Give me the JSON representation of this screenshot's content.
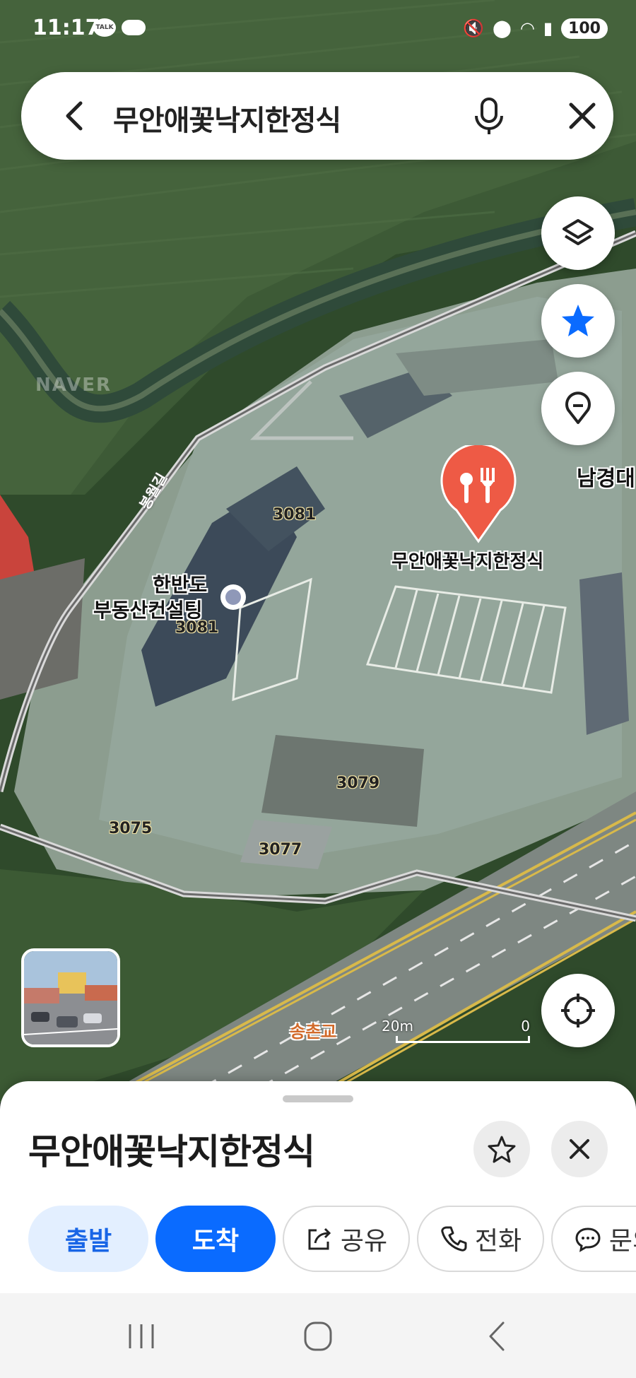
{
  "status_bar": {
    "time": "11:17",
    "talk_badge": "TALK",
    "battery": "100",
    "icons": [
      "kakaotalk-icon",
      "cloud-icon",
      "mute-vibrate-icon",
      "location-icon",
      "wifi-icon",
      "signal-icon",
      "battery-icon"
    ]
  },
  "search": {
    "query": "무안애꽃낙지한정식"
  },
  "map": {
    "watermark": "NAVER",
    "road_name": "봉월길",
    "place_label": "무안애꽃낙지한정식",
    "nearby_place_line1": "한반도",
    "nearby_place_line2": "부동산컨설팅",
    "edge_label": "남경대",
    "bridge_label": "송촌교",
    "lot_numbers": [
      "3081",
      "3081",
      "3079",
      "3075",
      "3077"
    ],
    "scale_left": "20m",
    "scale_right": "0",
    "accent_pin_color": "#ee5a45"
  },
  "sheet": {
    "title": "무안애꽃낙지한정식",
    "actions": {
      "depart": "출발",
      "arrive": "도착",
      "share": "공유",
      "call": "전화",
      "inquire": "문의"
    },
    "brand_color": "#0a6bff"
  }
}
